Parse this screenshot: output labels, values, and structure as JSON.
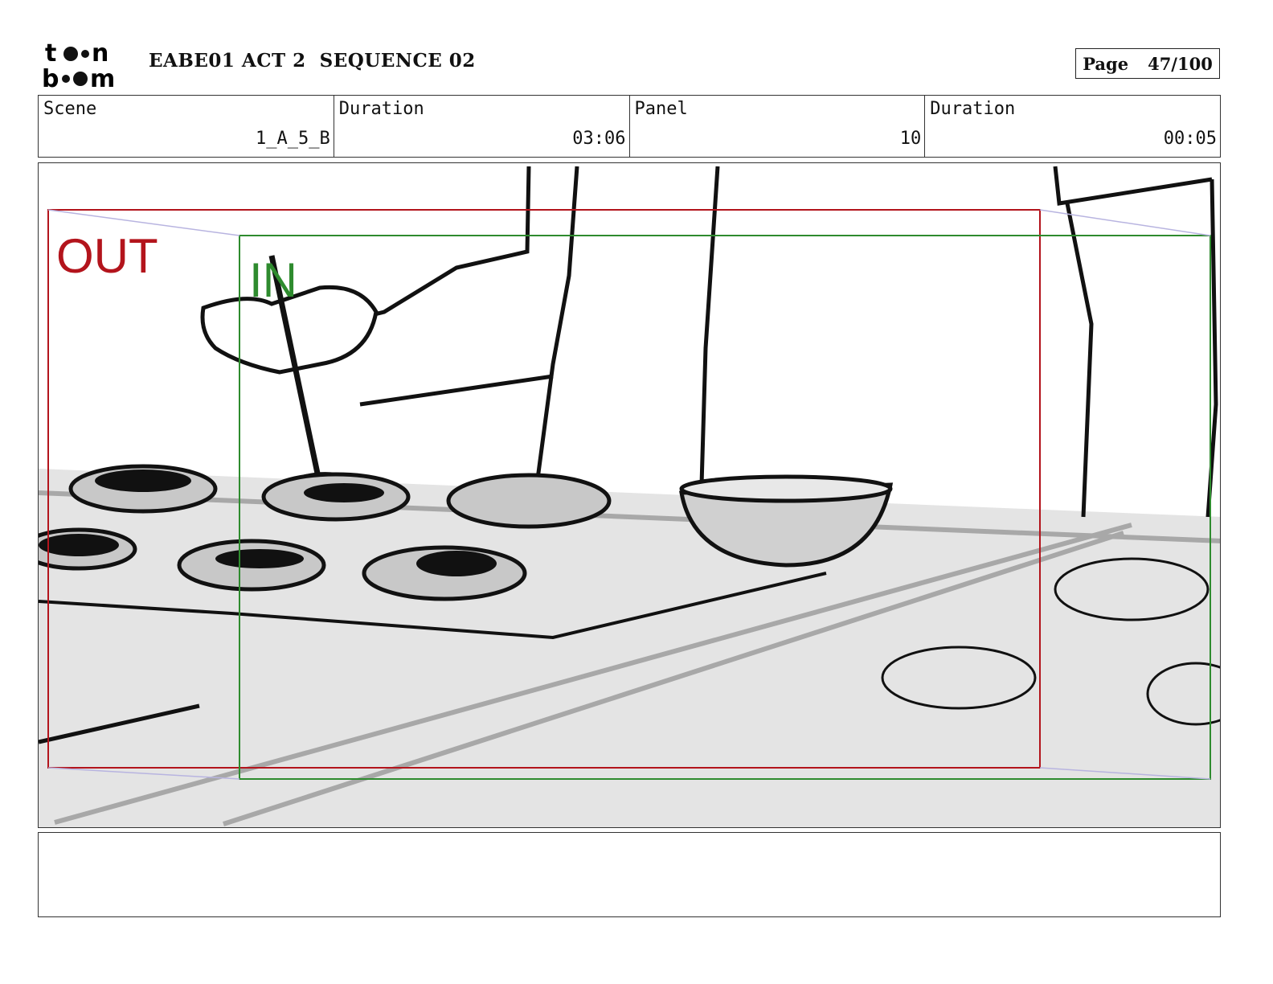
{
  "header": {
    "logo_top": "to•n",
    "logo_bottom": "b••m",
    "title": "EABE01 ACT 2  SEQUENCE 02",
    "page_label": "Page",
    "page_value": "47/100"
  },
  "info": [
    {
      "label": "Scene",
      "value": "1_A_5_B"
    },
    {
      "label": "Duration",
      "value": "03:06"
    },
    {
      "label": "Panel",
      "value": "10"
    },
    {
      "label": "Duration",
      "value": "00:05"
    }
  ],
  "panel": {
    "out_label": "OUT",
    "in_label": "IN",
    "out_color": "#b3141c",
    "in_color": "#2e8b2e"
  },
  "notes": {
    "text": ""
  }
}
